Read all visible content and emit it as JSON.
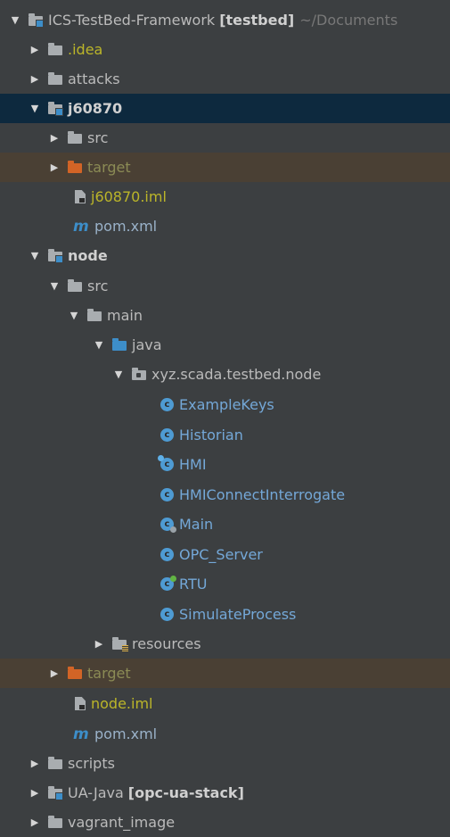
{
  "tree": {
    "root": {
      "name": "ICS-TestBed-Framework",
      "module": "[testbed]",
      "path": "~/Documents"
    },
    "idea": ".idea",
    "attacks": "attacks",
    "j60870": {
      "name": "j60870",
      "src": "src",
      "target": "target",
      "iml": "j60870.iml",
      "pom": "pom.xml"
    },
    "node": {
      "name": "node",
      "src": "src",
      "main": "main",
      "java": "java",
      "package": "xyz.scada.testbed.node",
      "classes": [
        "ExampleKeys",
        "Historian",
        "HMI",
        "HMIConnectInterrogate",
        "Main",
        "OPC_Server",
        "RTU",
        "SimulateProcess"
      ],
      "resources": "resources",
      "target": "target",
      "iml": "node.iml",
      "pom": "pom.xml"
    },
    "scripts": "scripts",
    "ua_java": {
      "name": "UA-Java",
      "module": "[opc-ua-stack]"
    },
    "vagrant": "vagrant_image"
  },
  "icons": {
    "expanded": "chevron-down-icon",
    "collapsed": "chevron-right-icon",
    "folder": "folder-icon",
    "class": "class-icon",
    "maven": "maven-icon",
    "iml": "iml-file-icon"
  },
  "colors": {
    "background": "#3c3f41",
    "selected_row": "#0d293e",
    "excluded_row": "#4a4034",
    "excluded_folder": "#d26426",
    "source_folder": "#3d8ec9",
    "class_icon": "#4e9bd3"
  }
}
